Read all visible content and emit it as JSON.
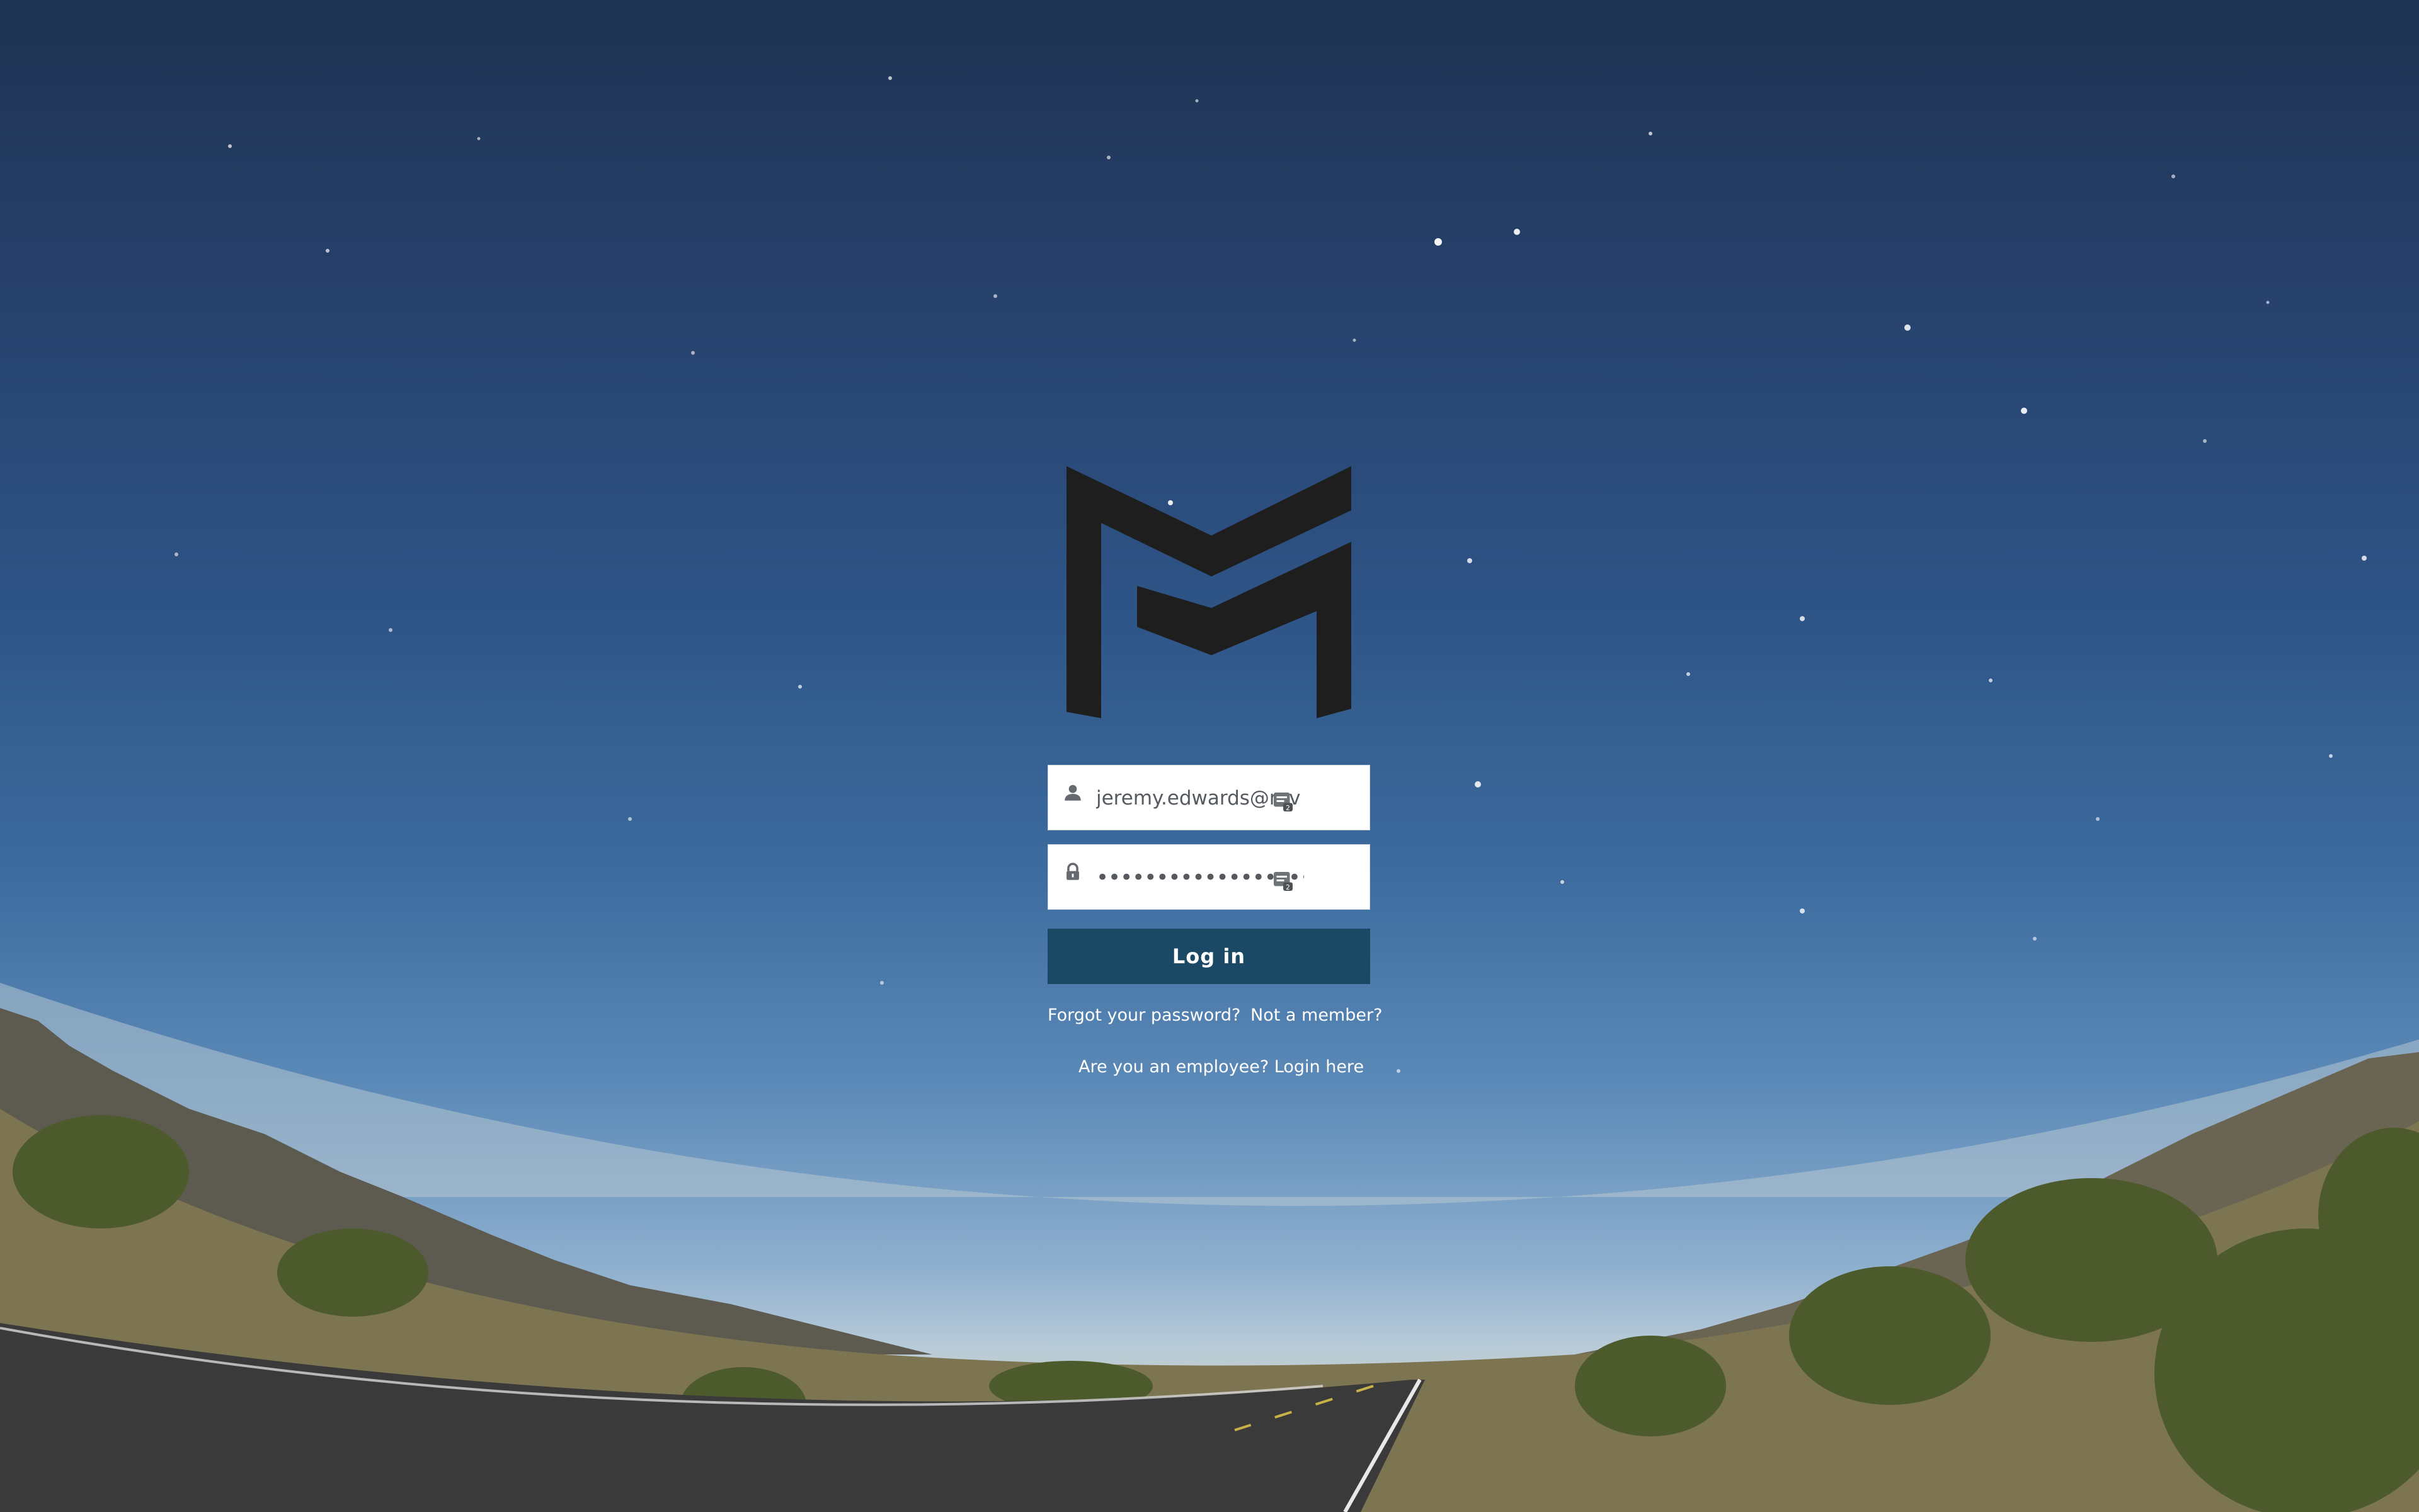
{
  "login": {
    "username_value": "jeremy.edwards@rev",
    "password_value": "••••••••••••••••••",
    "login_label": "Log in",
    "forgot_label": "Forgot your password?",
    "not_member_label": "Not a member?",
    "employee_label": "Are you an employee? Login here"
  },
  "icons": {
    "username": "person-icon",
    "password": "lock-icon",
    "autofill": "password-manager-icon"
  },
  "colors": {
    "button_bg": "#1b4965",
    "logo": "#1e1e1e",
    "link_text": "#ffffff"
  }
}
